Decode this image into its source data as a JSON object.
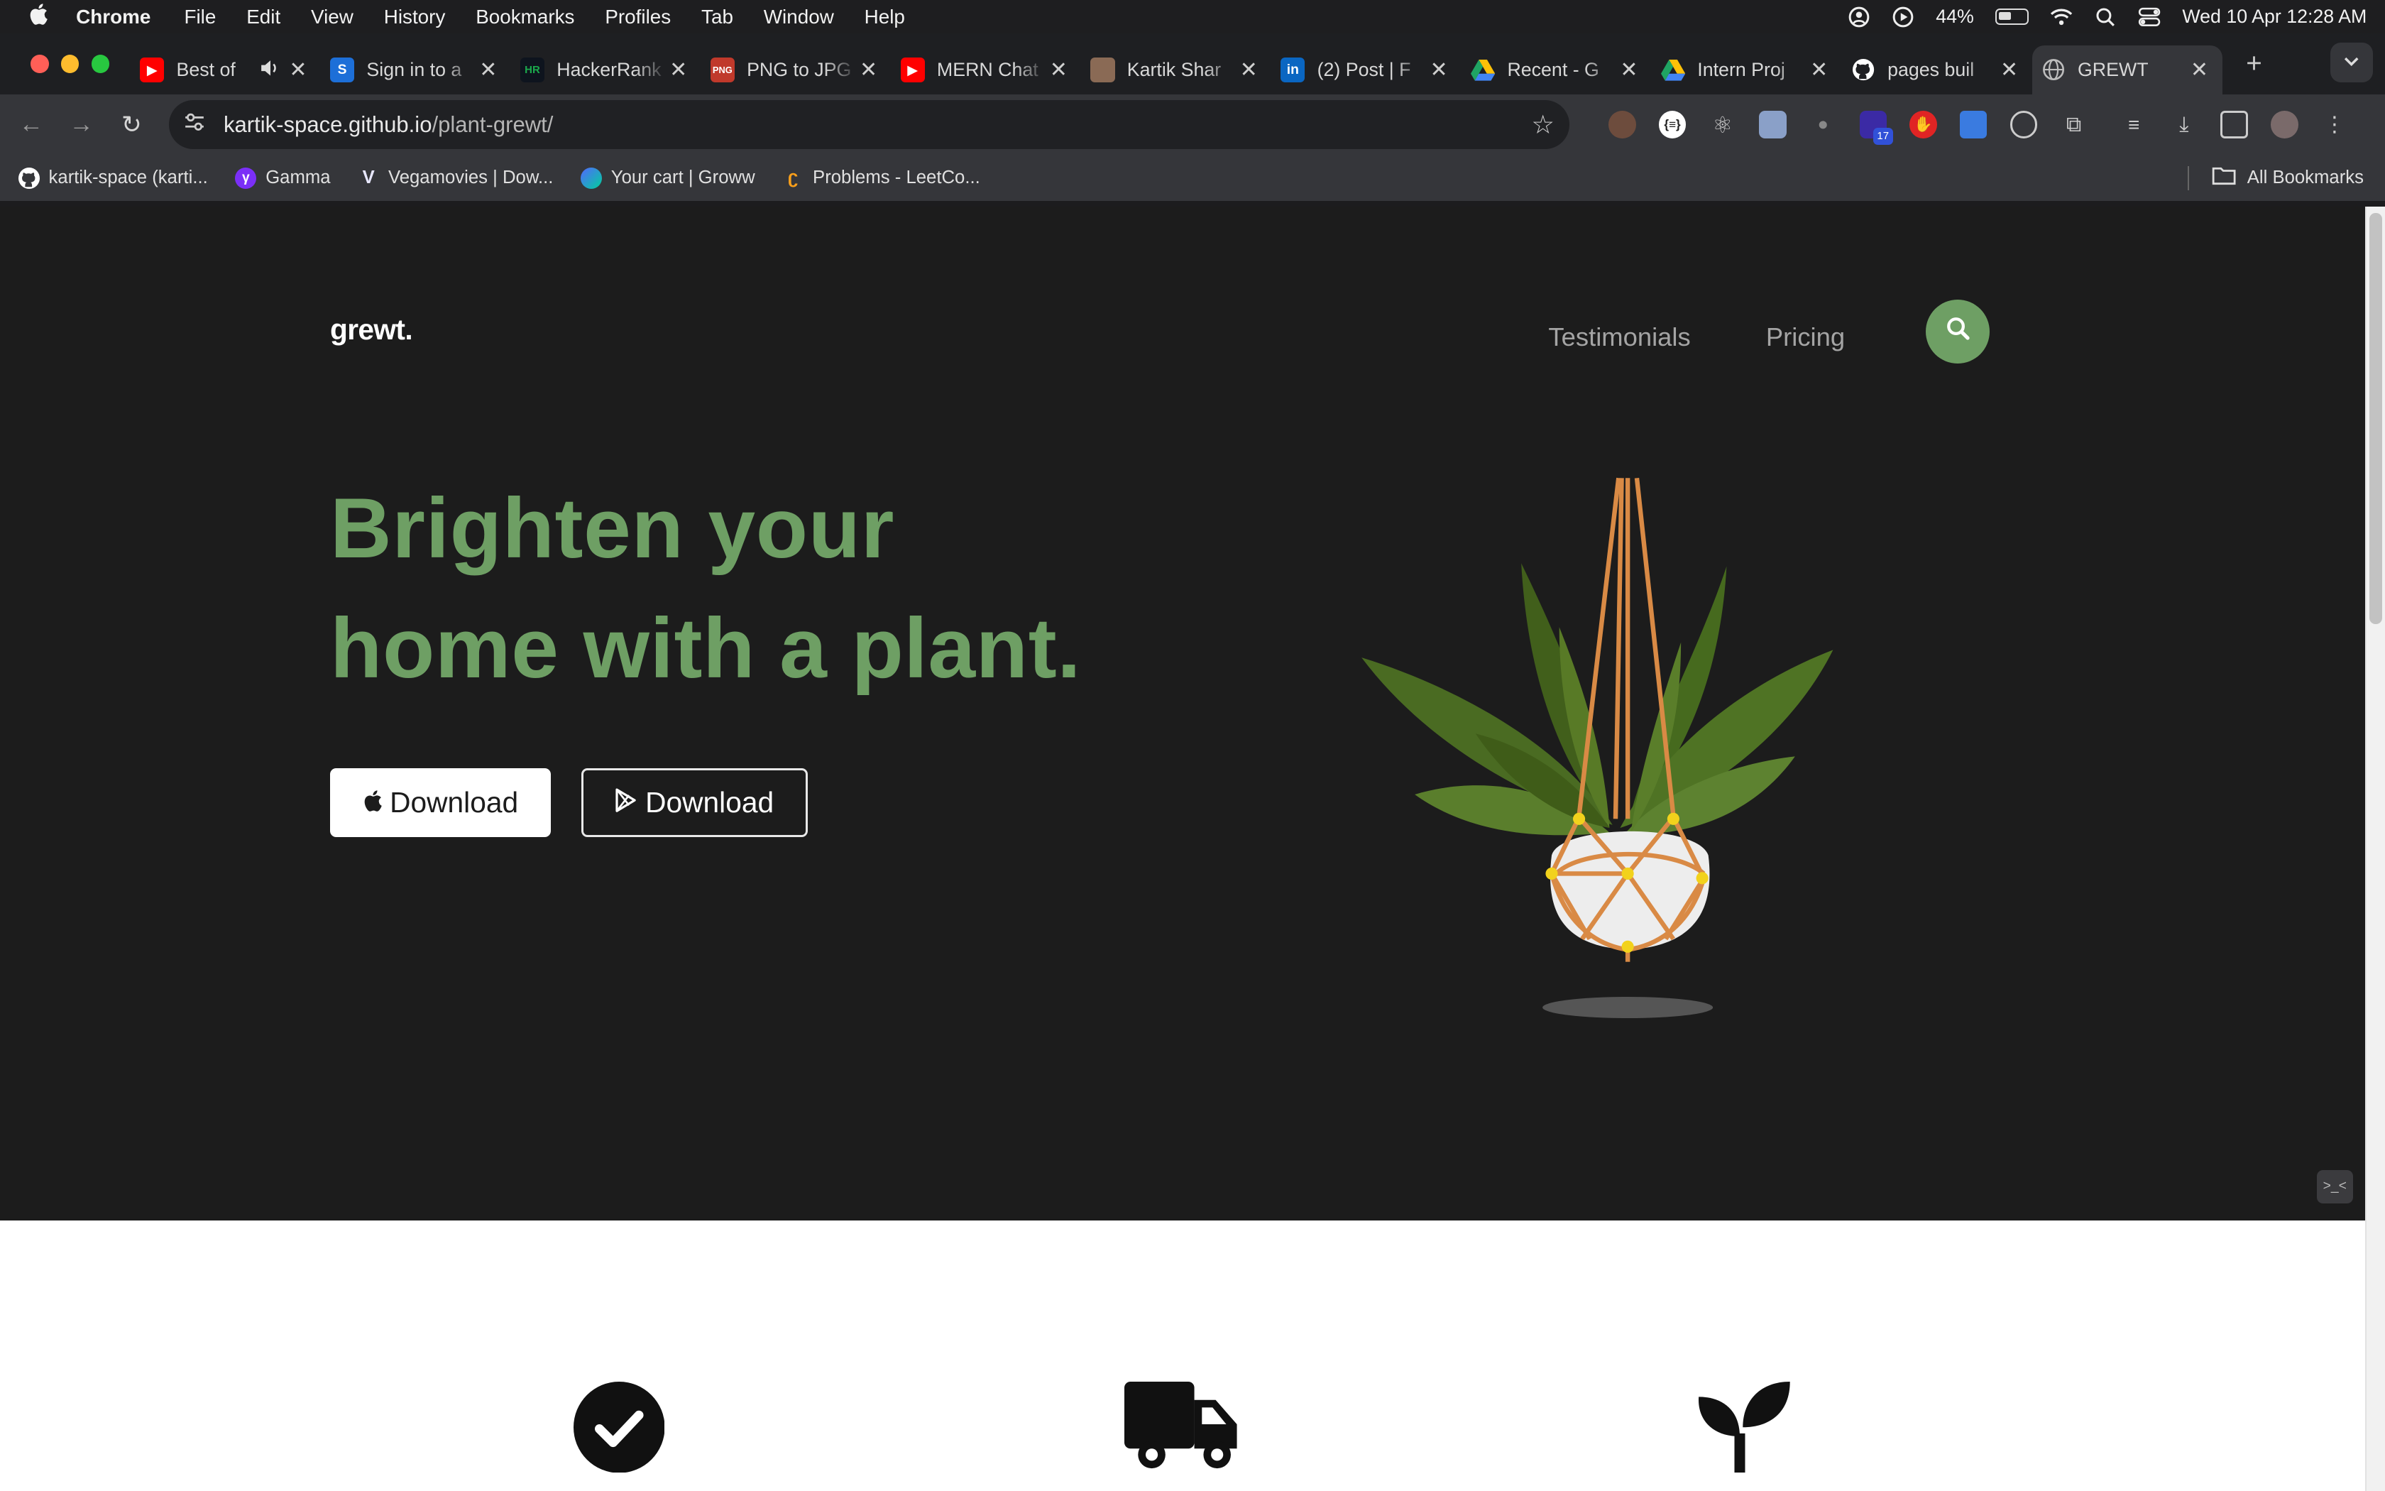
{
  "menubar": {
    "app_name": "Chrome",
    "menus": [
      "File",
      "Edit",
      "View",
      "History",
      "Bookmarks",
      "Profiles",
      "Tab",
      "Window",
      "Help"
    ],
    "battery_percent": "44%",
    "clock": "Wed 10 Apr  12:28 AM"
  },
  "tabs": [
    {
      "title": "Best of",
      "icon": "youtube-icon",
      "color": "#ff0000",
      "has_audio": true
    },
    {
      "title": "Sign in to a",
      "icon": "s-brand-icon",
      "color": "#1d6fd8"
    },
    {
      "title": "HackerRank",
      "icon": "hackerrank-icon",
      "color": "#1ba94c"
    },
    {
      "title": "PNG to JPG",
      "icon": "png-jpg-icon",
      "color": "#c0392b"
    },
    {
      "title": "MERN Chat",
      "icon": "youtube-icon",
      "color": "#ff0000"
    },
    {
      "title": "Kartik Shar",
      "icon": "profile-photo-icon",
      "color": "#8a6a55"
    },
    {
      "title": "(2) Post | F",
      "icon": "linkedin-icon",
      "color": "#0a66c2"
    },
    {
      "title": "Recent - G",
      "icon": "google-drive-icon",
      "color": "#1fa463"
    },
    {
      "title": "Intern Proj",
      "icon": "google-drive-icon",
      "color": "#1fa463"
    },
    {
      "title": "pages buil",
      "icon": "github-icon",
      "color": "#ffffff"
    },
    {
      "title": "GREWT",
      "icon": "globe-icon",
      "color": "#bdbdbd",
      "active": true
    }
  ],
  "address_bar": {
    "host": "kartik-space.github.io",
    "path": "/plant-grewt/"
  },
  "bookmarks": [
    {
      "label": "kartik-space (karti...",
      "icon": "github-icon"
    },
    {
      "label": "Gamma",
      "icon": "gamma-icon"
    },
    {
      "label": "Vegamovies | Dow...",
      "icon": "vegamovies-icon"
    },
    {
      "label": "Your cart | Groww",
      "icon": "groww-icon"
    },
    {
      "label": "Problems - LeetCo...",
      "icon": "leetcode-icon"
    }
  ],
  "all_bookmarks_label": "All Bookmarks",
  "extension_badge": "17",
  "site": {
    "logo": "grewt.",
    "nav": [
      "Testimonials",
      "Pricing"
    ],
    "headline_line1": "Brighten your",
    "headline_line2": "home with a plant.",
    "apple_button_label": "Download",
    "play_button_label": "Download",
    "features": [
      "check-circle-icon",
      "truck-icon",
      "seedling-icon"
    ]
  },
  "colors": {
    "brand_green": "#6e9f64",
    "page_bg": "#1c1c1c"
  }
}
